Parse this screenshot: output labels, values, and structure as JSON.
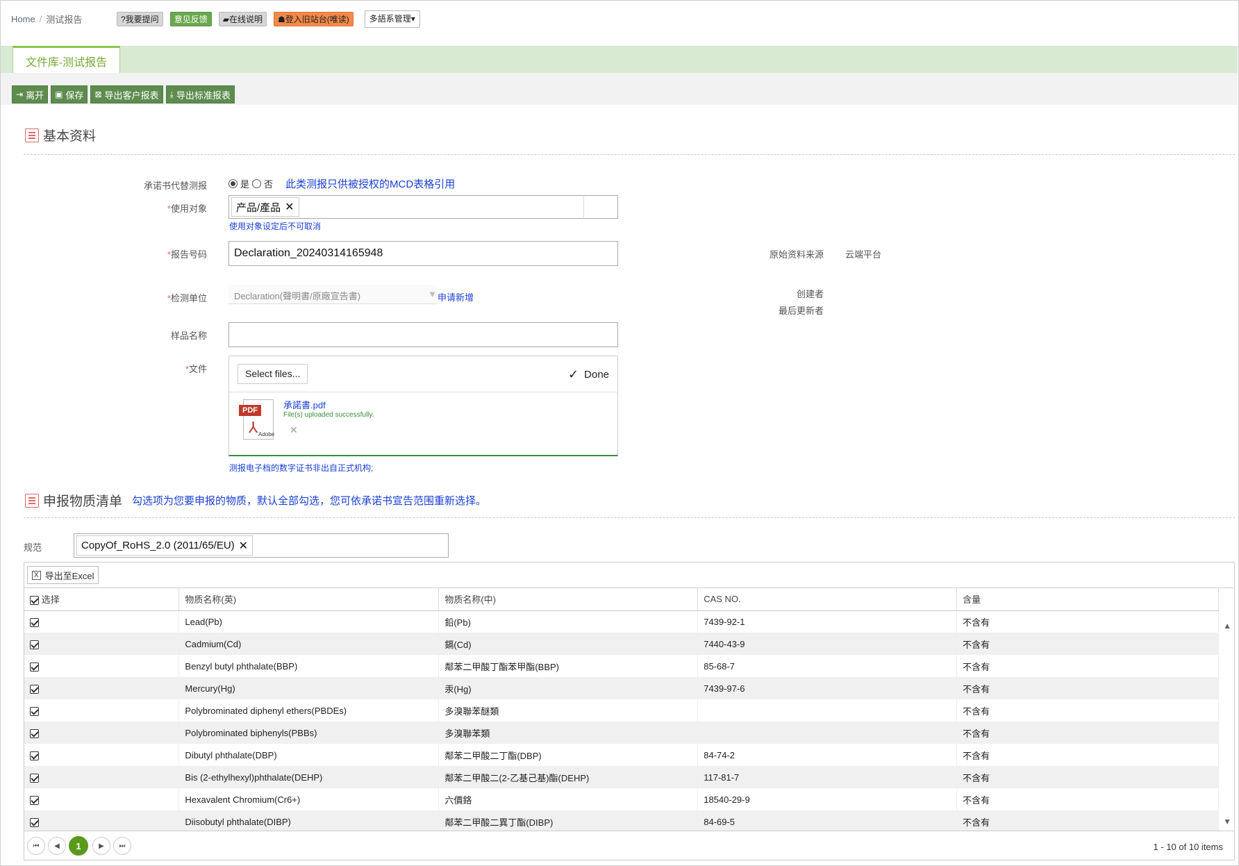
{
  "breadcrumb": {
    "home": "Home",
    "current": "测试报告"
  },
  "topbar": {
    "ask": "?我要提问",
    "feedback": "意见反馈",
    "manual": "在线说明",
    "old_site": "登入旧站台(唯读)",
    "lang": "多語系管理"
  },
  "tab": {
    "label": "文件库-测试报告"
  },
  "toolbar": {
    "leave": "离开",
    "save": "保存",
    "export_customer": "导出客户报表",
    "export_standard": "导出标准报表"
  },
  "basic": {
    "title": "基本资料",
    "commit_label": "承诺书代替测报",
    "yes": "是",
    "no": "否",
    "commit_note": "此类测报只供被授权的MCD表格引用",
    "target_label": "使用对象",
    "target_value": "产品/產品",
    "target_hint": "使用对象设定后不可取消",
    "report_label": "报告号码",
    "report_value": "Declaration_20240314165948",
    "source_label": "原始资料来源",
    "source_value": "云端平台",
    "lab_label": "检测单位",
    "lab_value": "Declaration(聲明書/原廠宣告書)",
    "lab_apply": "申请新增",
    "creator_label": "创建者",
    "updater_label": "最后更新者",
    "sample_label": "样品名称",
    "sample_value": "",
    "file_label": "文件",
    "select_files": "Select files...",
    "done": "Done",
    "file_name": "承諾書.pdf",
    "file_status": "File(s) uploaded successfully.",
    "file_note": "测报电子档的数字证书非出自正式机构;",
    "pdf_badge": "PDF",
    "adobe_label": "Adobe"
  },
  "substances": {
    "title": "申报物质清单",
    "note": "勾选项为您要申报的物质，默认全部勾选，您可依承诺书宣告范围重新选择。",
    "spec_label": "规范",
    "spec_value": "CopyOf_RoHS_2.0 (2011/65/EU)",
    "export_excel": "导出至Excel",
    "columns": [
      "选择",
      "物质名称(英)",
      "物质名称(中)",
      "CAS NO.",
      "含量"
    ],
    "rows": [
      {
        "en": "Lead(Pb)",
        "zh": "鉛(Pb)",
        "cas": "7439-92-1",
        "amt": "不含有"
      },
      {
        "en": "Cadmium(Cd)",
        "zh": "鎘(Cd)",
        "cas": "7440-43-9",
        "amt": "不含有"
      },
      {
        "en": "Benzyl butyl phthalate(BBP)",
        "zh": "鄰苯二甲酸丁酯苯甲酯(BBP)",
        "cas": "85-68-7",
        "amt": "不含有"
      },
      {
        "en": "Mercury(Hg)",
        "zh": "汞(Hg)",
        "cas": "7439-97-6",
        "amt": "不含有"
      },
      {
        "en": "Polybrominated diphenyl ethers(PBDEs)",
        "zh": "多溴聯苯醚類",
        "cas": "",
        "amt": "不含有"
      },
      {
        "en": "Polybrominated biphenyls(PBBs)",
        "zh": "多溴聯苯類",
        "cas": "",
        "amt": "不含有"
      },
      {
        "en": "Dibutyl phthalate(DBP)",
        "zh": "鄰苯二甲酸二丁酯(DBP)",
        "cas": "84-74-2",
        "amt": "不含有"
      },
      {
        "en": "Bis (2-ethylhexyl)phthalate(DEHP)",
        "zh": "鄰苯二甲酸二(2-乙基己基)酯(DEHP)",
        "cas": "117-81-7",
        "amt": "不含有"
      },
      {
        "en": "Hexavalent Chromium(Cr6+)",
        "zh": "六價鉻",
        "cas": "18540-29-9",
        "amt": "不含有"
      },
      {
        "en": "Diisobutyl phthalate(DIBP)",
        "zh": "鄰苯二甲酸二異丁酯(DIBP)",
        "cas": "84-69-5",
        "amt": "不含有"
      }
    ],
    "page": "1",
    "page_info": "1 - 10 of 10 items"
  }
}
